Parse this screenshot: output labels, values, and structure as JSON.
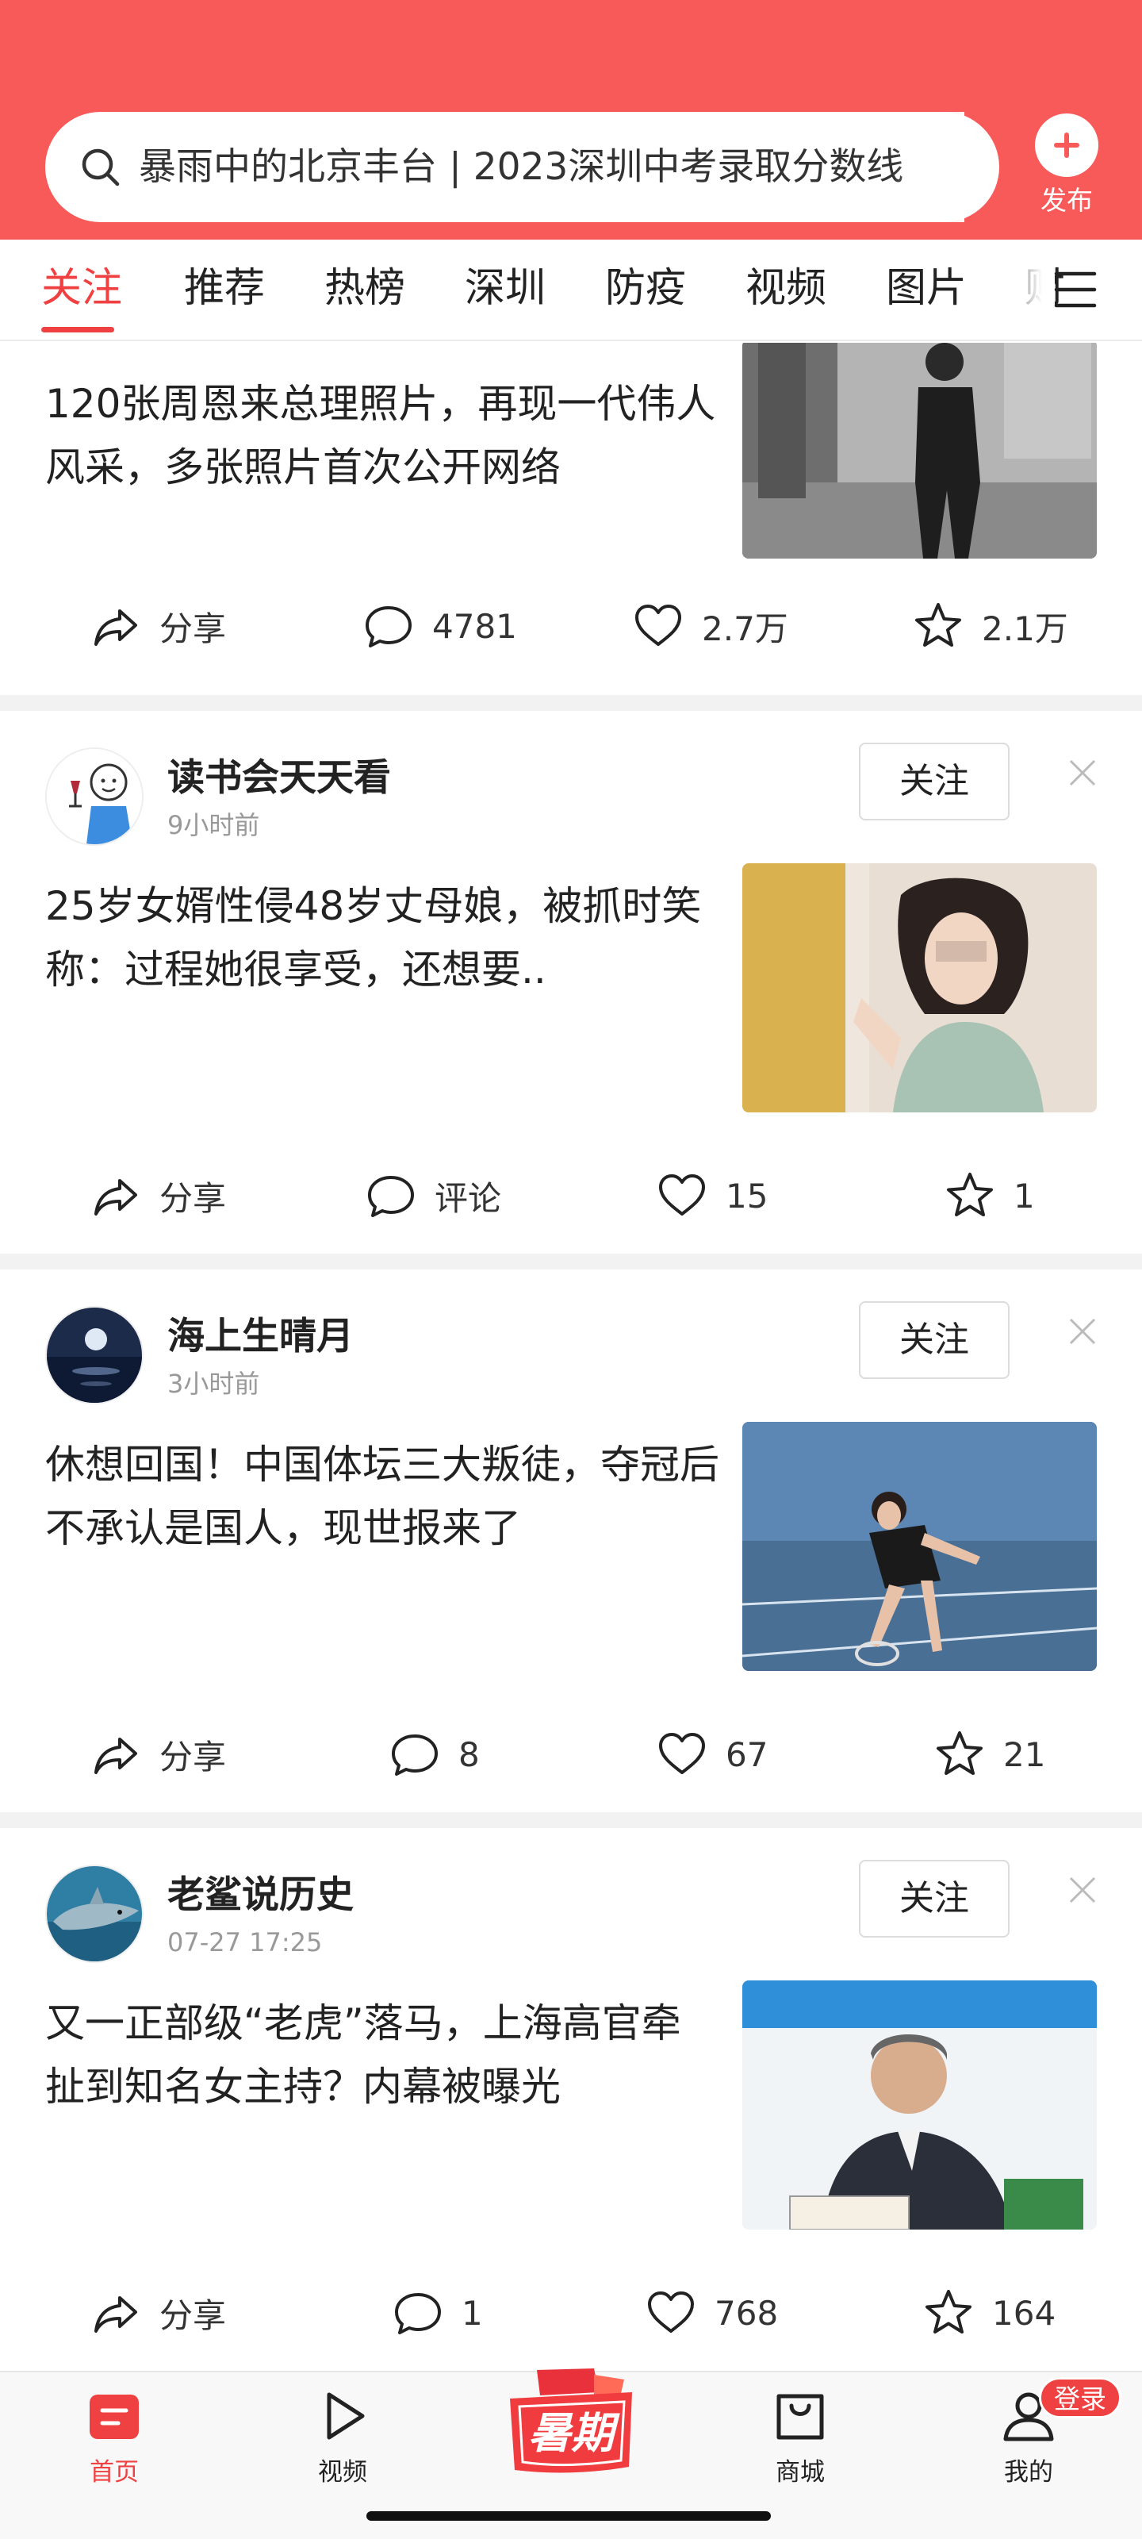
{
  "search": {
    "query": "暴雨中的北京丰台 | 2023深圳中考录取分数线"
  },
  "header": {
    "publish_label": "发布"
  },
  "tabs": [
    {
      "label": "关注",
      "active": true
    },
    {
      "label": "推荐"
    },
    {
      "label": "热榜"
    },
    {
      "label": "深圳"
    },
    {
      "label": "防疫"
    },
    {
      "label": "视频"
    },
    {
      "label": "图片"
    },
    {
      "label": "财"
    }
  ],
  "feed": [
    {
      "title": "120张周恩来总理照片，再现一代伟人风采，多张照片首次公开网络",
      "actions": {
        "share": "分享",
        "comment": "4781",
        "like": "2.7万",
        "favorite": "2.1万"
      }
    },
    {
      "author": "读书会天天看",
      "time": "9小时前",
      "follow_label": "关注",
      "title": "25岁女婿性侵48岁丈母娘，被抓时笑称：过程她很享受，还想要..",
      "actions": {
        "share": "分享",
        "comment": "评论",
        "like": "15",
        "favorite": "1"
      }
    },
    {
      "author": "海上生晴月",
      "time": "3小时前",
      "follow_label": "关注",
      "title": "休想回国！中国体坛三大叛徒，夺冠后不承认是国人，现世报来了",
      "actions": {
        "share": "分享",
        "comment": "8",
        "like": "67",
        "favorite": "21"
      }
    },
    {
      "author": "老鲨说历史",
      "time": "07-27 17:25",
      "follow_label": "关注",
      "title": "又一正部级“老虎”落马，上海高官牵扯到知名女主持？内幕被曝光",
      "actions": {
        "share": "分享",
        "comment": "1",
        "like": "768",
        "favorite": "164"
      }
    }
  ],
  "bottom_nav": {
    "items": [
      {
        "label": "首页",
        "icon": "home-icon",
        "active": true
      },
      {
        "label": "视频",
        "icon": "play-icon"
      },
      {
        "label": "暑期",
        "icon": "summer-campaign-icon"
      },
      {
        "label": "商城",
        "icon": "shopping-bag-icon"
      },
      {
        "label": "我的",
        "icon": "user-icon"
      }
    ],
    "summer_text": "暑期",
    "login_badge": "登录"
  },
  "colors": {
    "brand": "#f85959",
    "accent": "#f04142"
  }
}
